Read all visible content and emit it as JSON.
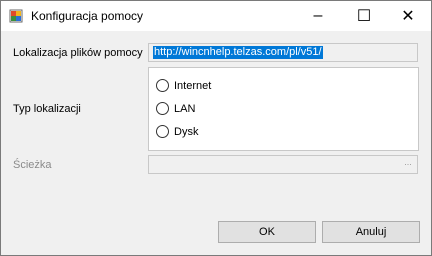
{
  "window": {
    "title": "Konfiguracja pomocy",
    "controls": {
      "minimize": "–",
      "maximize": "☐",
      "close": "✕"
    }
  },
  "form": {
    "location_label": "Lokalizacja plików pomocy",
    "location_value": "http://wincnhelp.telzas.com/pl/v51/",
    "type_label": "Typ lokalizacji",
    "options": [
      "Internet",
      "LAN",
      "Dysk"
    ],
    "path_label": "Ścieżka",
    "path_value": "",
    "browse_label": "..."
  },
  "buttons": {
    "ok": "OK",
    "cancel": "Anuluj"
  },
  "colors": {
    "selection": "#0078d7",
    "disabled_text": "#8a8a8a"
  },
  "icons": {
    "app": "help-config-icon"
  }
}
